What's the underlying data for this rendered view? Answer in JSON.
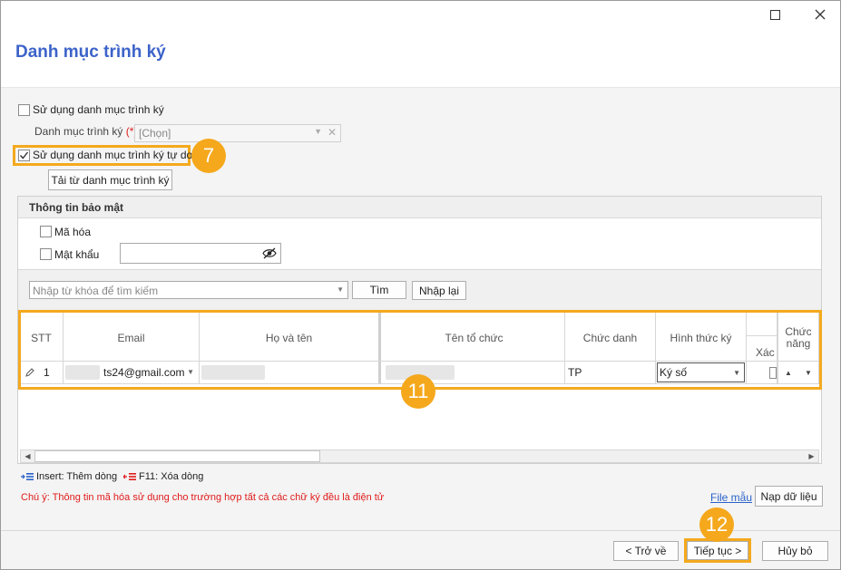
{
  "window": {
    "maximize_icon": "maximize-icon",
    "close_icon": "close-icon"
  },
  "title": "Danh mục trình ký",
  "options": {
    "use_catalog_label": "Sử dụng danh mục trình ký",
    "use_catalog_checked": false,
    "catalog_label": "Danh mục trình ký",
    "required_mark": "(*)",
    "catalog_placeholder": "[Chọn]",
    "free_catalog_label": "Sử dụng danh mục trình ký tự do",
    "free_catalog_checked": true,
    "load_button": "Tải từ danh mục trình ký"
  },
  "security": {
    "heading": "Thông tin bảo mật",
    "encrypt_label": "Mã hóa",
    "password_label": "Mật khẩu",
    "eye_icon": "eye-slash-icon"
  },
  "search": {
    "placeholder": "Nhập từ khóa để tìm kiếm",
    "find_button": "Tìm",
    "reset_button": "Nhập lại"
  },
  "table": {
    "columns": [
      "STT",
      "Email",
      "Họ và tên",
      "Tên tổ chức",
      "Chức danh",
      "Hình thức ký",
      "Xác",
      "Chức năng"
    ],
    "rows": [
      {
        "stt": "1",
        "email": "ts24@gmail.com",
        "name": "",
        "organization": "",
        "title": "TP",
        "sign_type": "Ký số"
      }
    ]
  },
  "shortcuts": {
    "insert": "Insert: Thêm dòng",
    "delete": "F11: Xóa dòng"
  },
  "note": "Chú ý: Thông tin mã hóa sử dụng cho trường hợp tất cả các chữ ký đều là điện tử",
  "file_template": "File mẫu",
  "load_data": "Nạp dữ liệu",
  "footer": {
    "back": "< Trở về",
    "next": "Tiếp tục >",
    "cancel": "Hủy bỏ"
  },
  "annotations": {
    "step7": "7",
    "step11": "11",
    "step12": "12"
  },
  "colors": {
    "title": "#3c63c9",
    "highlight": "#f4a91d",
    "note": "#e01b1b",
    "link": "#2a62c9"
  }
}
